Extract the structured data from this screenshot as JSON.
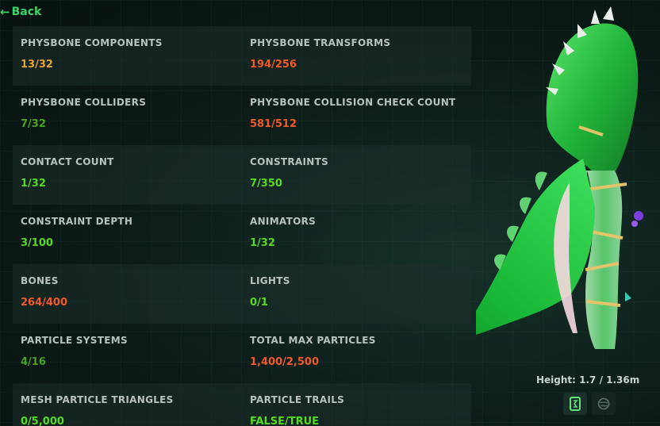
{
  "nav": {
    "back_label": "Back"
  },
  "colors": {
    "ok": "#58d923",
    "warn": "#e6a431",
    "over": "#f05a2a",
    "dim_ok": "#4aa31e"
  },
  "stats": [
    {
      "label": "PHYSBONE COMPONENTS",
      "value": "13/32",
      "status": "warn"
    },
    {
      "label": "PHYSBONE TRANSFORMS",
      "value": "194/256",
      "status": "over"
    },
    {
      "label": "PHYSBONE COLLIDERS",
      "value": "7/32",
      "status": "dim_ok"
    },
    {
      "label": "PHYSBONE COLLISION CHECK COUNT",
      "value": "581/512",
      "status": "over"
    },
    {
      "label": "CONTACT COUNT",
      "value": "1/32",
      "status": "ok"
    },
    {
      "label": "CONSTRAINTS",
      "value": "7/350",
      "status": "ok"
    },
    {
      "label": "CONSTRAINT DEPTH",
      "value": "3/100",
      "status": "ok"
    },
    {
      "label": "ANIMATORS",
      "value": "1/32",
      "status": "ok"
    },
    {
      "label": "BONES",
      "value": "264/400",
      "status": "over"
    },
    {
      "label": "LIGHTS",
      "value": "0/1",
      "status": "ok"
    },
    {
      "label": "PARTICLE SYSTEMS",
      "value": "4/16",
      "status": "dim_ok"
    },
    {
      "label": "TOTAL MAX PARTICLES",
      "value": "1,400/2,500",
      "status": "over"
    },
    {
      "label": "MESH PARTICLE TRIANGLES",
      "value": "0/5,000",
      "status": "ok"
    },
    {
      "label": "PARTICLE TRAILS",
      "value": "FALSE/TRUE",
      "status": "ok"
    }
  ],
  "avatar": {
    "height_label": "Height: 1.7 / 1.36m",
    "view_toggle": {
      "selected": "front-view",
      "options": [
        "front-view-icon",
        "globe-view-icon"
      ]
    }
  }
}
